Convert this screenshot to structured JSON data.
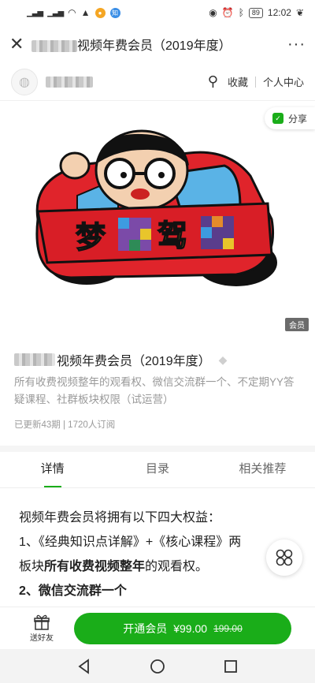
{
  "status_bar": {
    "signal1": "ᵃˡ",
    "signal2": "ᵃˡ",
    "battery": "89",
    "time": "12:02"
  },
  "title_bar": {
    "title_suffix": "视频年费会员（2019年度）",
    "more": "···"
  },
  "shop_bar": {
    "favorite_label": "收藏",
    "profile_label": "个人中心"
  },
  "hero": {
    "share_label": "分享",
    "banner_text_1": "梦",
    "banner_text_2": "驾",
    "member_tag": "会员"
  },
  "product": {
    "title_suffix": "视频年费会员（2019年度）",
    "description": "所有收费视频整年的观看权、微信交流群一个、不定期YY答疑课程、社群板块权限（试运营）",
    "meta": "已更新43期 | 1720人订阅"
  },
  "tabs": [
    {
      "label": "详情",
      "active": true
    },
    {
      "label": "目录",
      "active": false
    },
    {
      "label": "相关推荐",
      "active": false
    }
  ],
  "content": {
    "line1": "视频年费会员将拥有以下四大权益：",
    "line2": "1、《经典知识点详解》+《核心课程》两",
    "line3_pre": "板块",
    "line3_bold": "所有收费视频整年",
    "line3_post": "的观看权。",
    "line4": "2、微信交流群一个"
  },
  "action_bar": {
    "gift_label": "送好友",
    "join_label": "开通会员",
    "price": "¥99.00",
    "original_price": "199.00"
  },
  "colors": {
    "accent": "#1aad19",
    "car_body": "#e0242b",
    "banner_text": "#f4e02a"
  }
}
